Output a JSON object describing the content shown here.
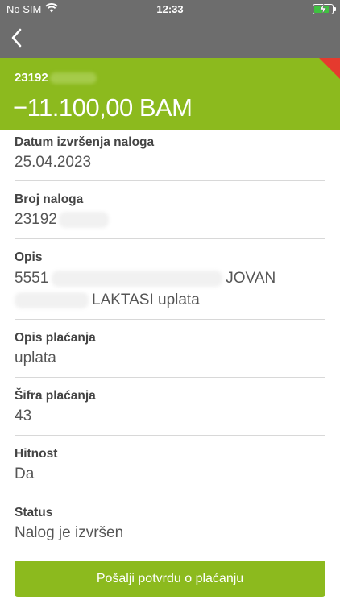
{
  "status_bar": {
    "carrier": "No SIM",
    "time": "12:33",
    "battery_level": 0.85,
    "icons": [
      "wifi-icon",
      "battery-charging-icon"
    ]
  },
  "nav": {
    "back_icon": "chevron-left-icon"
  },
  "header": {
    "order_number": "23192",
    "amount": "−11.100,00 BAM",
    "colors": {
      "background": "#8cba1e",
      "flag": "#e53a2e"
    }
  },
  "details": {
    "execution_date": {
      "label": "Datum izvršenja naloga",
      "value": "25.04.2023"
    },
    "order_number": {
      "label": "Broj naloga",
      "value": "23192"
    },
    "description": {
      "label": "Opis",
      "line1_start": "5551",
      "line1_end": "JOVAN",
      "line2_end": "LAKTASI uplata"
    },
    "payment_description": {
      "label": "Opis plaćanja",
      "value": "uplata"
    },
    "payment_code": {
      "label": "Šifra plaćanja",
      "value": "43"
    },
    "urgency": {
      "label": "Hitnost",
      "value": "Da"
    },
    "status": {
      "label": "Status",
      "value": "Nalog je izvršen"
    }
  },
  "actions": {
    "send_confirmation": "Pošalji potvrdu o plaćanju"
  }
}
